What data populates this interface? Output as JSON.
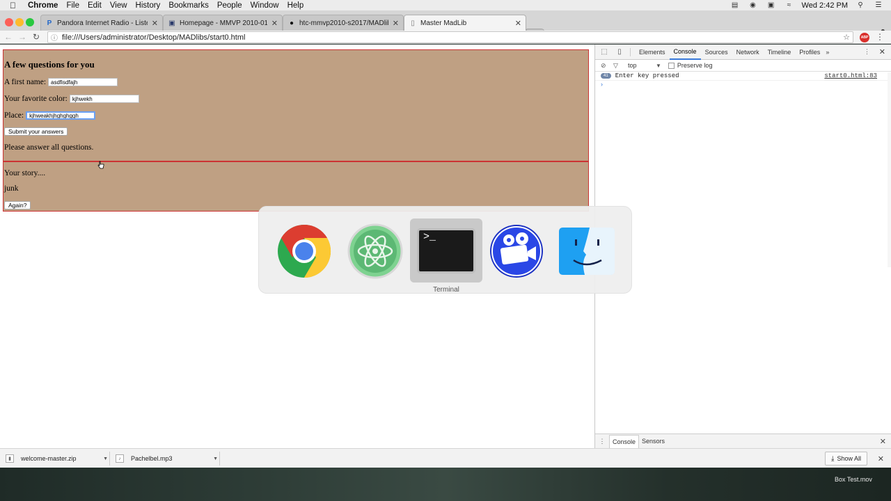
{
  "menubar": {
    "apple": "",
    "app_name": "Chrome",
    "items": [
      "File",
      "Edit",
      "View",
      "History",
      "Bookmarks",
      "People",
      "Window",
      "Help"
    ],
    "clock": "Wed 2:42 PM"
  },
  "tabs": [
    {
      "label": "Pandora Internet Radio - Liste",
      "favicon": "P"
    },
    {
      "label": "Homepage - MMVP 2010-01",
      "favicon": "▣"
    },
    {
      "label": "htc-mmvp2010-s2017/MADlib",
      "favicon": "●"
    },
    {
      "label": "Master MadLib",
      "favicon": "▯",
      "active": true
    }
  ],
  "toolbar": {
    "url": "file:///Users/administrator/Desktop/MADlibs/start0.html"
  },
  "madlib": {
    "heading": "A few questions for you",
    "fields": [
      {
        "label": "A first name:",
        "value": "asdfisdfajh"
      },
      {
        "label": "Your favorite color:",
        "value": "kjhwekh"
      },
      {
        "label": "Place:",
        "value": "kjhweakhjhghghggh"
      }
    ],
    "submit_label": "Submit your answers",
    "message": "Please answer all questions.",
    "story_heading": "Your story....",
    "story_text": "junk",
    "again_label": "Again?"
  },
  "devtools": {
    "tabs": [
      "Elements",
      "Console",
      "Sources",
      "Network",
      "Timeline",
      "Profiles"
    ],
    "more": "»",
    "context": "top",
    "preserve_log": "Preserve log",
    "log_count": "41",
    "log_message": "Enter key pressed",
    "log_source": "start0.html:83",
    "prompt": "›",
    "drawer_tabs": [
      "Console",
      "Sensors"
    ]
  },
  "switcher": {
    "apps": [
      "Chrome",
      "Atom",
      "Terminal",
      "iMovie",
      "Finder"
    ],
    "selected_label": "Terminal",
    "terminal_glyph": ">_"
  },
  "downloads": {
    "items": [
      "welcome-master.zip",
      "Pachelbel.mp3"
    ],
    "show_all": "Show All"
  },
  "desktop": {
    "file_label": "Box Test.mov"
  },
  "colors": {
    "madlib_bg": "#bfa083",
    "madlib_border": "#cc3333",
    "accent": "#3879d9"
  }
}
